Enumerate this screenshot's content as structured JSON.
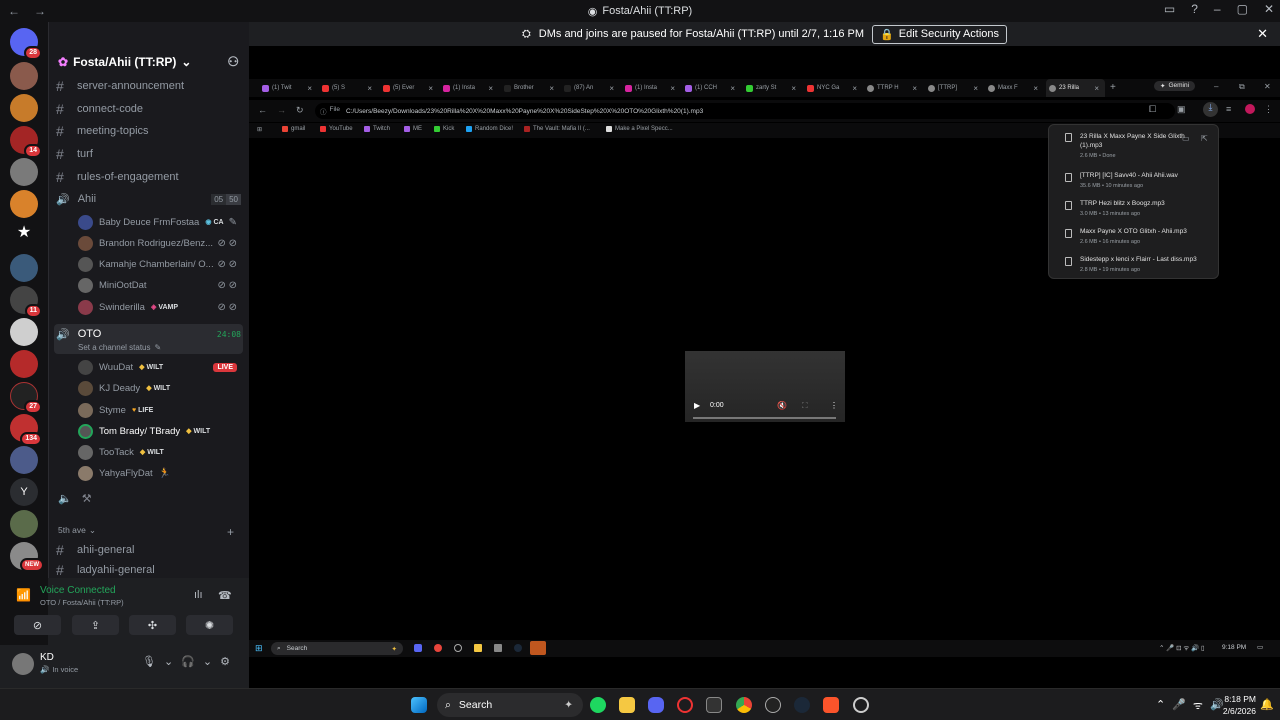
{
  "window": {
    "title": "Fosta/Ahii (TT:RP)"
  },
  "banner": {
    "text": "DMs and joins are paused for Fosta/Ahii (TT:RP) until 2/7, 1:16 PM",
    "button": "Edit Security Actions"
  },
  "server": {
    "name": "Fosta/Ahii (TT:RP)"
  },
  "server_badges": [
    "28",
    "14",
    "11",
    "27",
    "134",
    "Y",
    "NEW"
  ],
  "channels_top": [
    "server-announcement",
    "connect-code",
    "meeting-topics",
    "turf",
    "rules-of-engagement"
  ],
  "voice_ahii": {
    "name": "Ahii",
    "count_a": "05",
    "count_b": "50",
    "users": [
      {
        "name": "Baby Deuce FrmFostaa",
        "tag": "CA"
      },
      {
        "name": "Brandon Rodriguez/Benz...",
        "tag": ""
      },
      {
        "name": "Kamahje Chamberlain/ O...",
        "tag": ""
      },
      {
        "name": "MiniOotDat",
        "tag": ""
      },
      {
        "name": "Swinderilla",
        "tag": "VAMP"
      }
    ]
  },
  "voice_oto": {
    "name": "OTO",
    "time": "24:08",
    "status": "Set a channel status",
    "users": [
      {
        "name": "WuuDat",
        "tag": "WILT",
        "live": "LIVE"
      },
      {
        "name": "KJ Deady",
        "tag": "WILT"
      },
      {
        "name": "Styme",
        "tag": "LIFE"
      },
      {
        "name": "Tom Brady/ TBrady",
        "tag": "WILT"
      },
      {
        "name": "TooTack",
        "tag": "WILT"
      },
      {
        "name": "YahyaFlyDat",
        "tag": ""
      }
    ]
  },
  "category": {
    "name": "5th ave"
  },
  "channels_bottom": [
    "ahii-general",
    "ladyahii-general"
  ],
  "voice_status": {
    "title": "Voice Connected",
    "sub": "OTO / Fosta/Ahii (TT:RP)"
  },
  "user": {
    "name": "KD",
    "status": "In voice"
  },
  "browser": {
    "tabs": [
      "(1) Twit",
      "(5) S",
      "(5) Ever",
      "(1) Insta",
      "Brother",
      "(87) An",
      "(1) Insta",
      "(1) CCH",
      "zarty St",
      "NYC Ga",
      "TTRP H",
      "[TTRP]",
      "Maxx F",
      "23 Rilla"
    ],
    "gemini": "Gemini",
    "file_label": "File",
    "url": "C:/Users/Beezy/Downloads/23%20Rilla%20X%20Maxx%20Payne%20X%20SideStep%20X%20OTO%20Glixth%20(1).mp3",
    "bookmarks": [
      "gmail",
      "YouTube",
      "Twitch",
      "ME",
      "Kick",
      "Random Dice!",
      "The Vault: Mafia II (...",
      "Make a Pixel Specc..."
    ],
    "downloads": [
      {
        "name": "23 Rilla X Maxx Payne X Side Glixth (1).mp3",
        "meta": "2.6 MB • Done"
      },
      {
        "name": "[TTRP] [IC] Savv40 - Ahii Ahii.wav",
        "meta": "35.6 MB • 10 minutes ago"
      },
      {
        "name": "TTRP Hezi blitz x Boogz.mp3",
        "meta": "3.0 MB • 13 minutes ago"
      },
      {
        "name": "Maxx Payne X OTO Glitxh - Ahii.mp3",
        "meta": "2.6 MB • 16 minutes ago"
      },
      {
        "name": "Sidestepp x lenci x Flairr - Last diss.mp3",
        "meta": "2.8 MB • 19 minutes ago"
      }
    ],
    "player_time": "0:00"
  },
  "inner_taskbar": {
    "search": "Search",
    "time": "9:18 PM"
  },
  "taskbar": {
    "search": "Search",
    "time": "8:18 PM",
    "date": "2/6/2026"
  }
}
